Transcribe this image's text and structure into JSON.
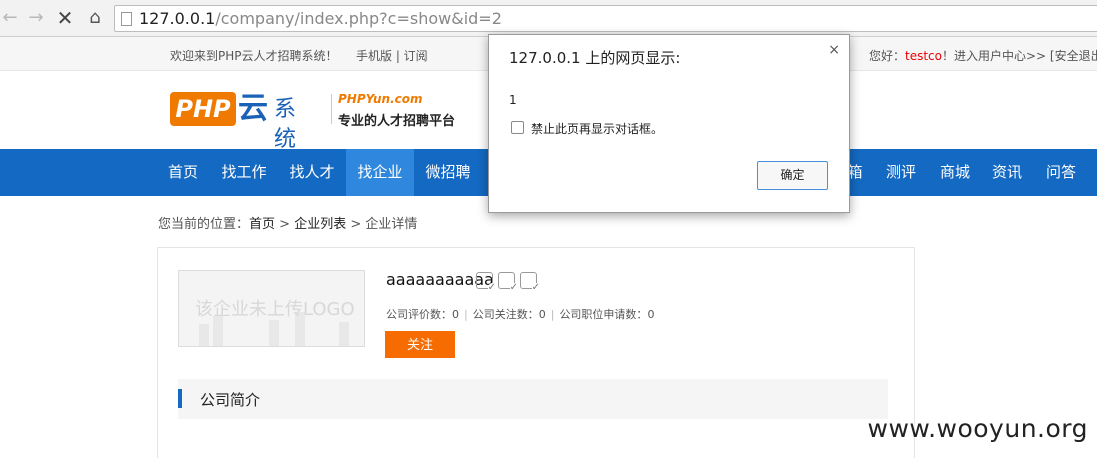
{
  "browser": {
    "url_host": "127.0.0.1",
    "url_path": "/company/index.php?c=show&id=2"
  },
  "topbar": {
    "welcome": "欢迎来到PHP云人才招聘系统！",
    "mobile": "手机版 | 订阅",
    "greeting_prefix": "您好：",
    "username": "testco",
    "greeting_suffix": "！进入用户中心>> [安全退出]"
  },
  "logo": {
    "php": "PHP",
    "yun": "云",
    "xitong": "系统",
    "domain": "PHPYun.com",
    "slogan": "专业的人才招聘平台"
  },
  "nav": {
    "items": [
      {
        "label": "首页"
      },
      {
        "label": "找工作"
      },
      {
        "label": "找人才"
      },
      {
        "label": "找企业"
      },
      {
        "label": "微招聘"
      },
      {
        "label": "箱"
      },
      {
        "label": "测评"
      },
      {
        "label": "商城"
      },
      {
        "label": "资讯"
      },
      {
        "label": "问答"
      }
    ],
    "active_index": 3,
    "color": "#1469c2"
  },
  "breadcrumb": {
    "prefix": "您当前的位置：",
    "home": "首页",
    "list": "企业列表",
    "current": "企业详情",
    "separator": ">"
  },
  "company": {
    "logo_placeholder": "该企业未上传LOGO",
    "name": "aaaaaaaaaaa",
    "cert_icons": [
      "email-verified-icon",
      "phone-verified-icon",
      "license-verified-icon"
    ],
    "stats": [
      {
        "label": "公司评价数：",
        "value": "0"
      },
      {
        "label": "公司关注数：",
        "value": "0"
      },
      {
        "label": "公司职位申请数：",
        "value": "0"
      }
    ],
    "follow_label": "关注",
    "section_title": "公司简介"
  },
  "dialog": {
    "title": "127.0.0.1 上的网页显示:",
    "close": "×",
    "message": "1",
    "checkbox_label": "禁止此页再显示对话框。",
    "ok_label": "确定"
  },
  "watermark": "www.wooyun.org"
}
